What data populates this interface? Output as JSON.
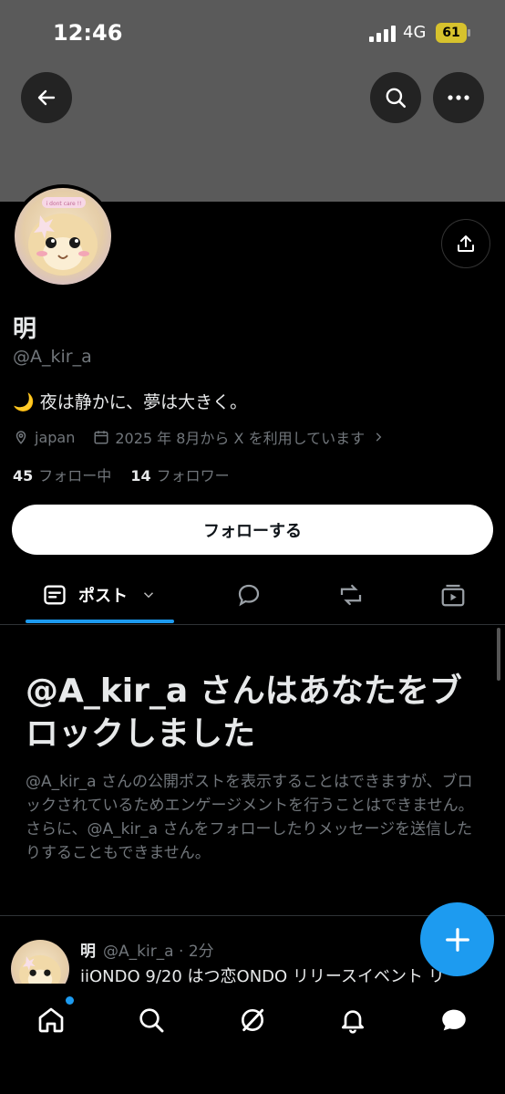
{
  "status_bar": {
    "time": "12:46",
    "network": "4G",
    "battery": "61"
  },
  "profile": {
    "name": "明",
    "handle": "@A_kir_a",
    "bio_emoji": "🌙",
    "bio": "夜は静かに、夢は大きく。",
    "location": "japan",
    "joined": "2025 年 8月から X を利用しています",
    "following_count": "45",
    "following_label": "フォロー中",
    "followers_count": "14",
    "followers_label": "フォロワー",
    "avatar_text": "i dont care !!"
  },
  "follow_button": "フォローする",
  "tabs": {
    "posts_label": "ポスト"
  },
  "blocked": {
    "title": "@A_kir_a さんはあなたをブロックしました",
    "description": "@A_kir_a さんの公開ポストを表示することはできますが、ブロックされているためエンゲージメントを行うことはできません。さらに、@A_kir_a さんをフォローしたりメッセージを送信したりすることもできません。"
  },
  "post": {
    "name": "明",
    "handle_time": "@A_kir_a · 2分",
    "text": "iiONDO 9/20 はつ恋ONDO リリースイベント リ"
  },
  "colors": {
    "accent": "#1d9bf0",
    "banner": "#5a5a5a",
    "battery": "#d7c22d"
  }
}
